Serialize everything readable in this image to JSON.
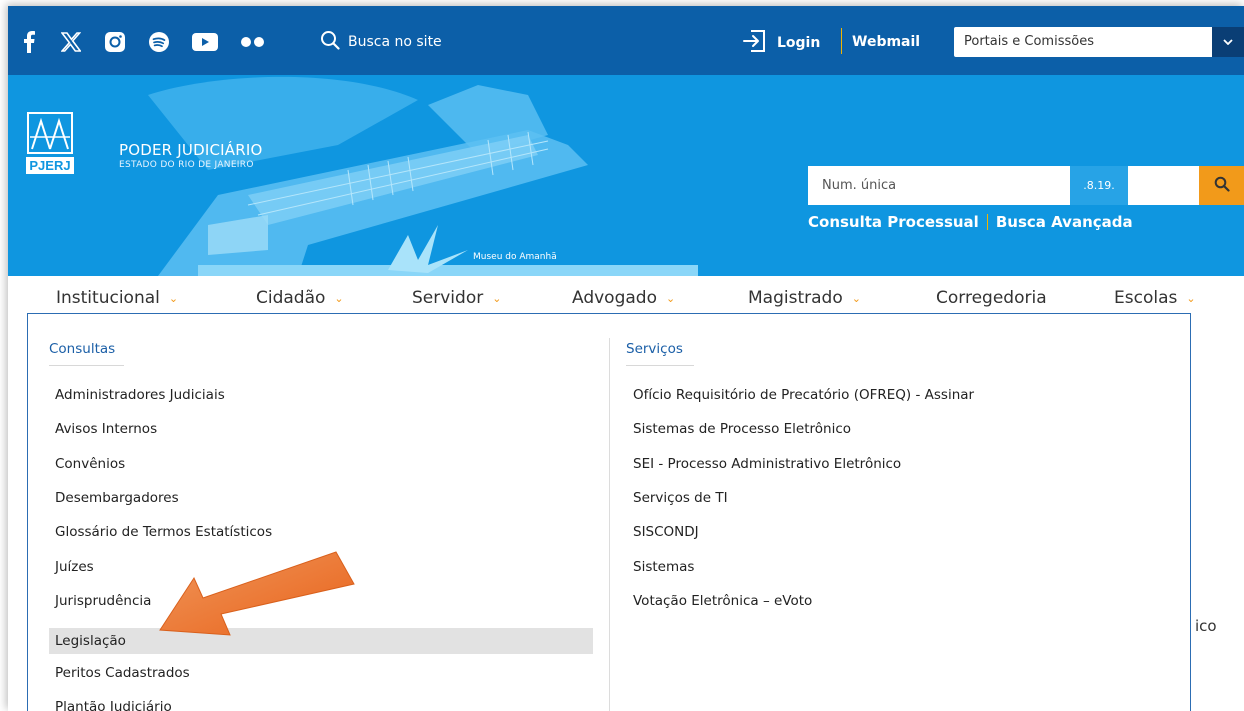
{
  "topbar": {
    "social_icons": [
      "facebook-icon",
      "x-icon",
      "instagram-icon",
      "spotify-icon",
      "youtube-icon",
      "flickr-icon"
    ],
    "search_label": "Busca no site",
    "login_label": "Login",
    "webmail_label": "Webmail",
    "portais_select": "Portais e Comissões"
  },
  "header": {
    "logo_text": "PJERJ",
    "org_title": "PODER JUDICIÁRIO",
    "org_subtitle": "ESTADO DO RIO DE JANEIRO",
    "photo_caption": "Museu do Amanhã",
    "consulta_link": "Consulta Processual",
    "busca_link": "Busca Avançada",
    "process_placeholder": "Num. única",
    "process_code": ".8.19."
  },
  "nav": {
    "items": [
      {
        "label": "Institucional",
        "chevron": true
      },
      {
        "label": "Cidadão",
        "chevron": true
      },
      {
        "label": "Servidor",
        "chevron": true
      },
      {
        "label": "Advogado",
        "chevron": true
      },
      {
        "label": "Magistrado",
        "chevron": true
      },
      {
        "label": "Corregedoria",
        "chevron": false
      },
      {
        "label": "Escolas",
        "chevron": true
      }
    ]
  },
  "menu": {
    "consultas": {
      "heading": "Consultas",
      "items": [
        "Administradores Judiciais",
        "Avisos Internos",
        "Convênios",
        "Desembargadores",
        "Glossário de Termos Estatísticos",
        "Juízes",
        "Jurisprudência",
        "Legislação",
        "Peritos Cadastrados",
        "Plantão Judiciário"
      ],
      "highlighted": "Legislação"
    },
    "servicos": {
      "heading": "Serviços",
      "items": [
        "Ofício Requisitório de Precatório (OFREQ) - Assinar",
        "Sistemas de Processo Eletrônico",
        "SEI - Processo Administrativo Eletrônico",
        "Serviços de TI",
        "SISCONDJ",
        "Sistemas",
        "Votação Eletrônica – eVoto"
      ]
    }
  },
  "background_fragment": "ico",
  "colors": {
    "topbar": "#0c5fa8",
    "hero": "#0f96e0",
    "accent_orange": "#f29a1a",
    "accent_gold": "#f0b400",
    "menu_border": "#2c6db3",
    "arrow": "#ec7a2c"
  }
}
